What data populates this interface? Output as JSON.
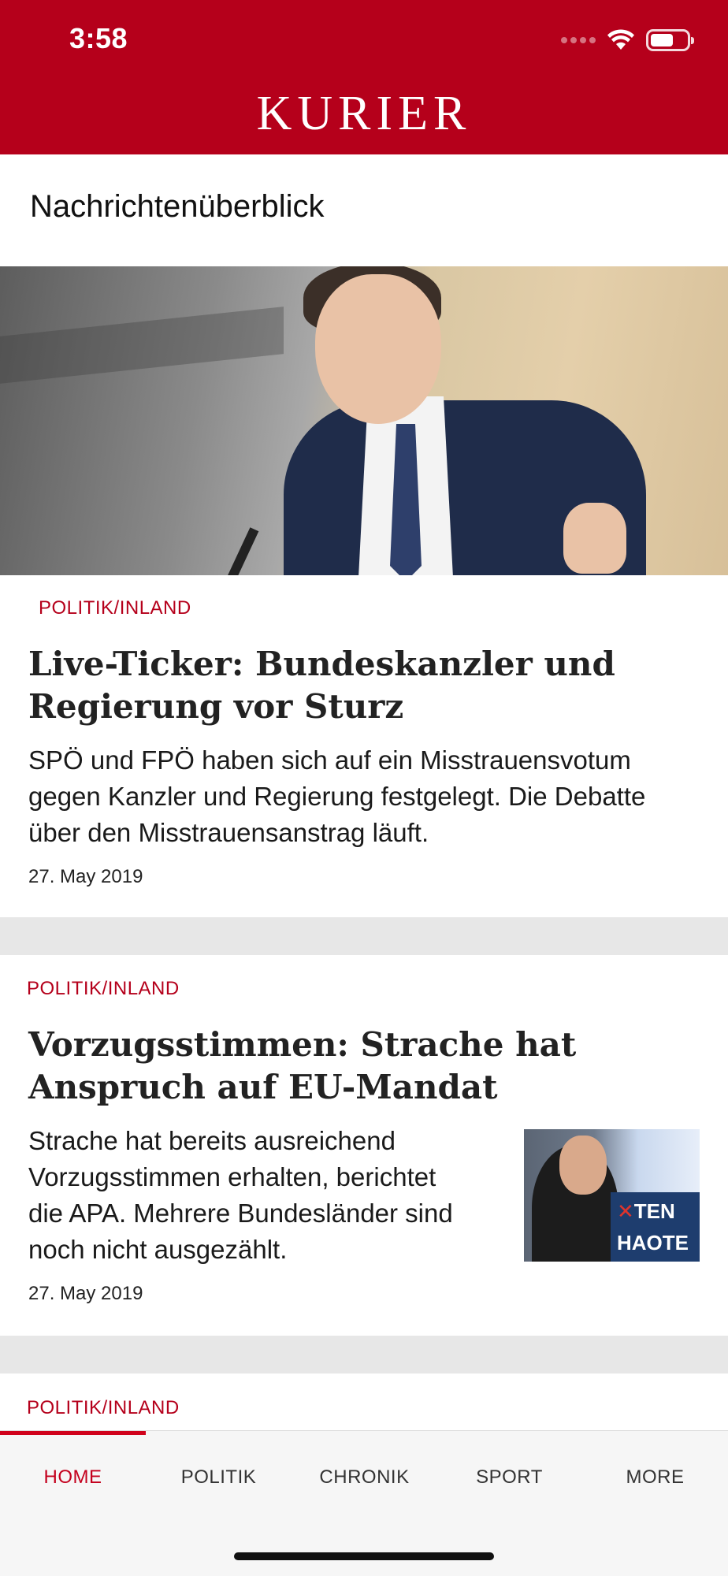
{
  "status_bar": {
    "time": "3:58"
  },
  "header": {
    "brand": "KURIER"
  },
  "section": {
    "title": "Nachrichtenüberblick"
  },
  "articles": [
    {
      "category": "POLITIK/INLAND",
      "headline_line1": "Live-Ticker: Bundeskanzler und",
      "headline_line2": "Regierung vor Sturz",
      "teaser_line1": "SPÖ und FPÖ haben sich auf ein Misstrauensvotum",
      "teaser_line2": "gegen Kanzler und Regierung festgelegt. Die Debatte",
      "teaser_line3": "über den Misstrauensanstrag läuft.",
      "date": "27. May 2019"
    },
    {
      "category": "POLITIK/INLAND",
      "headline_line1": "Vorzugsstimmen: Strache hat",
      "headline_line2": "Anspruch auf EU-Mandat",
      "teaser_line1": "Strache hat bereits ausreichend",
      "teaser_line2": "Vorzugsstimmen erhalten, berichtet",
      "teaser_line3": "die APA. Mehrere Bundesländer sind",
      "teaser_line4": "noch nicht ausgezählt.",
      "date": "27. May 2019"
    },
    {
      "category": "POLITIK/INLAND"
    }
  ],
  "tabs": [
    {
      "label": "HOME",
      "active": true
    },
    {
      "label": "POLITIK"
    },
    {
      "label": "CHRONIK"
    },
    {
      "label": "SPORT"
    },
    {
      "label": "MORE"
    }
  ],
  "colors": {
    "brand_red": "#b5001b",
    "separator": "#e7e7e7",
    "tabbar": "#f6f6f6"
  }
}
